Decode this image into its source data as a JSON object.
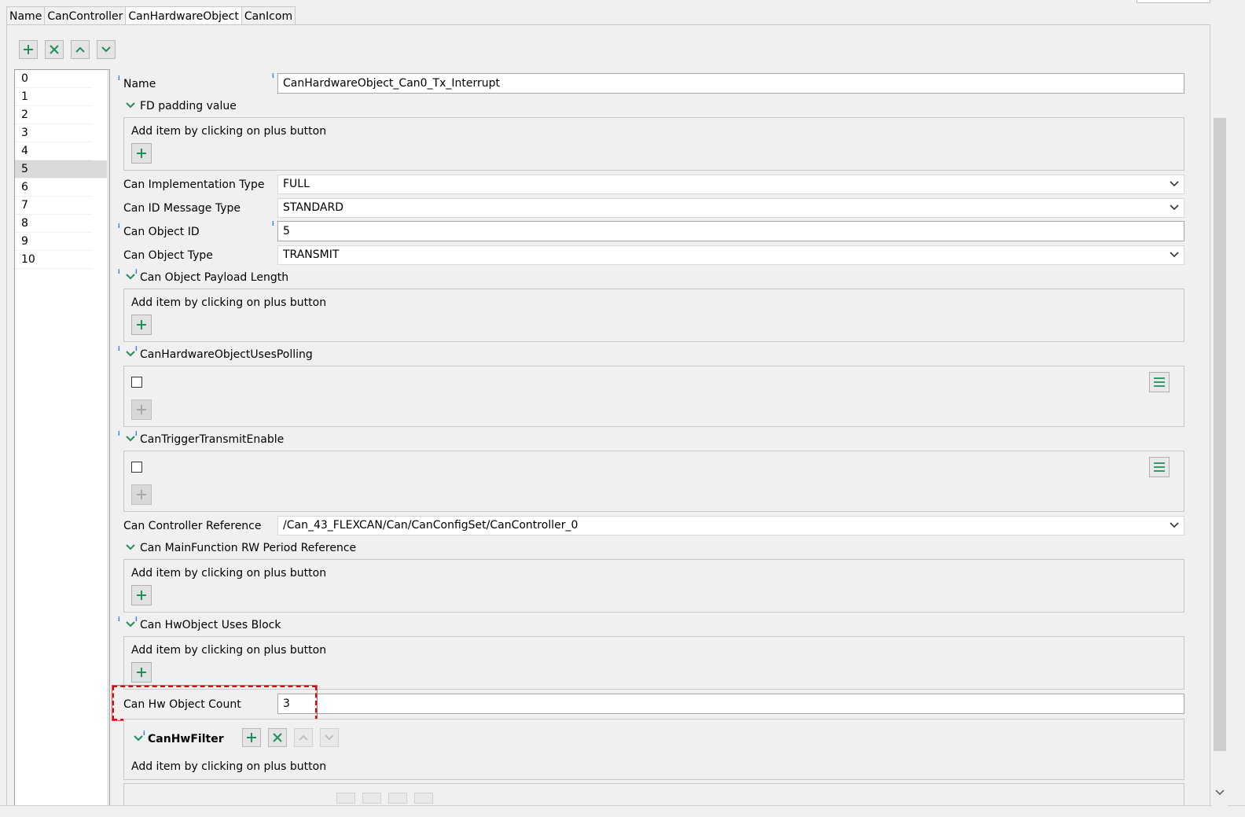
{
  "tabs": [
    "Name",
    "CanController",
    "CanHardwareObject",
    "CanIcom"
  ],
  "active_tab": "CanHardwareObject",
  "toolbar": {
    "add_icon": "plus-icon",
    "remove_icon": "x-icon",
    "up_icon": "chevron-up-icon",
    "down_icon": "chevron-down-icon"
  },
  "list": {
    "items": [
      "0",
      "1",
      "2",
      "3",
      "4",
      "5",
      "6",
      "7",
      "8",
      "9",
      "10"
    ],
    "selected": "5"
  },
  "form": {
    "name_label": "Name",
    "name_value": "CanHardwareObject_Can0_Tx_Interrupt",
    "fd_padding_label": "FD padding value",
    "add_hint": "Add item by clicking on plus button",
    "impl_type_label": "Can Implementation Type",
    "impl_type_value": "FULL",
    "id_msg_type_label": "Can ID Message Type",
    "id_msg_type_value": "STANDARD",
    "object_id_label": "Can Object ID",
    "object_id_value": "5",
    "object_type_label": "Can Object Type",
    "object_type_value": "TRANSMIT",
    "payload_len_label": "Can Object Payload Length",
    "uses_polling_label": "CanHardwareObjectUsesPolling",
    "trigger_tx_label": "CanTriggerTransmitEnable",
    "controller_ref_label": "Can Controller Reference",
    "controller_ref_value": "/Can_43_FLEXCAN/Can/CanConfigSet/CanController_0",
    "mainfunc_label": "Can MainFunction RW Period Reference",
    "uses_block_label": "Can HwObject Uses Block",
    "hw_count_label": "Can Hw Object Count",
    "hw_count_value": "3",
    "hw_filter_label": "CanHwFilter"
  },
  "colors": {
    "accent_green": "#1e8f5a",
    "highlight_red": "#d01010",
    "info_blue": "#2a7fd4"
  }
}
